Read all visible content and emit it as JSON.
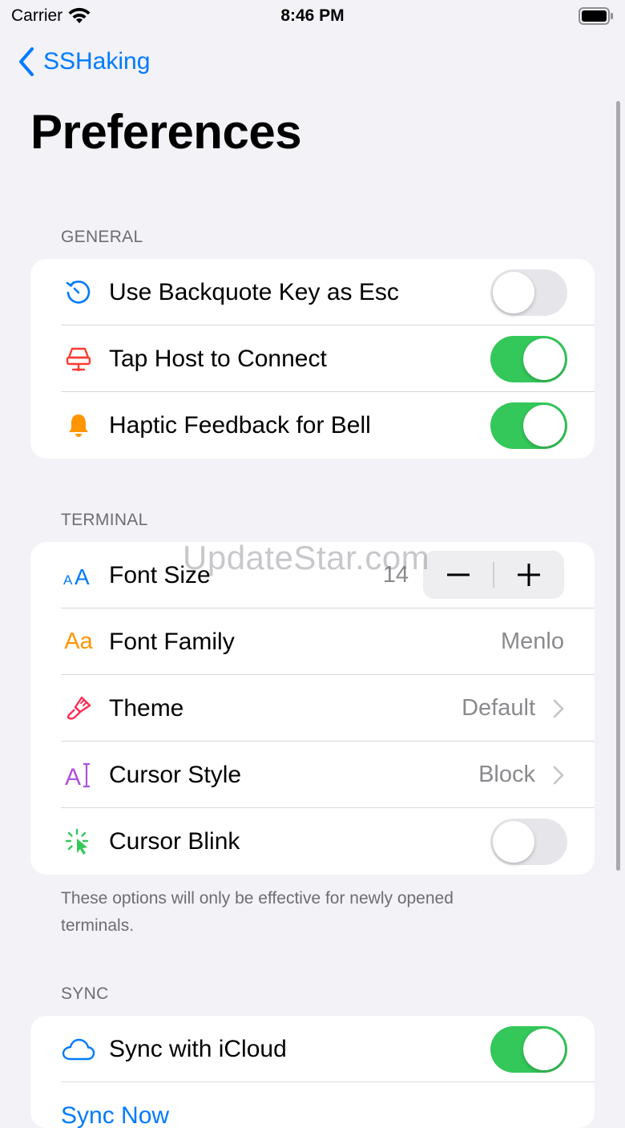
{
  "status_bar": {
    "carrier": "Carrier",
    "time": "8:46 PM"
  },
  "nav": {
    "back_label": "SSHaking"
  },
  "page_title": "Preferences",
  "general": {
    "header": "GENERAL",
    "rows": [
      {
        "label": "Use Backquote Key as Esc",
        "icon": "escape-arrow-icon",
        "on": false
      },
      {
        "label": "Tap Host to Connect",
        "icon": "server-host-icon",
        "on": true
      },
      {
        "label": "Haptic Feedback for Bell",
        "icon": "bell-icon",
        "on": true
      }
    ]
  },
  "terminal": {
    "header": "TERMINAL",
    "font_size": {
      "label": "Font Size",
      "value": "14",
      "icon": "text-size-icon"
    },
    "font_family": {
      "label": "Font Family",
      "value": "Menlo",
      "icon_text": "Aa"
    },
    "theme": {
      "label": "Theme",
      "value": "Default",
      "icon": "paintbrush-icon"
    },
    "cursor_style": {
      "label": "Cursor Style",
      "value": "Block",
      "icon_text": "A"
    },
    "cursor_blink": {
      "label": "Cursor Blink",
      "on": false,
      "icon": "cursor-click-icon"
    },
    "footer": "These options will only be effective for newly opened terminals."
  },
  "sync": {
    "header": "SYNC",
    "icloud": {
      "label": "Sync with iCloud",
      "on": true,
      "icon": "cloud-icon"
    },
    "sync_now": "Sync Now"
  },
  "watermark": "UpdateStar.com",
  "colors": {
    "accent": "#007AFF",
    "toggle_on": "#34C759",
    "red": "#FF3B30",
    "orange": "#FF9500",
    "purple": "#AF52DE",
    "green": "#34C759",
    "pink": "#FF2D55"
  }
}
